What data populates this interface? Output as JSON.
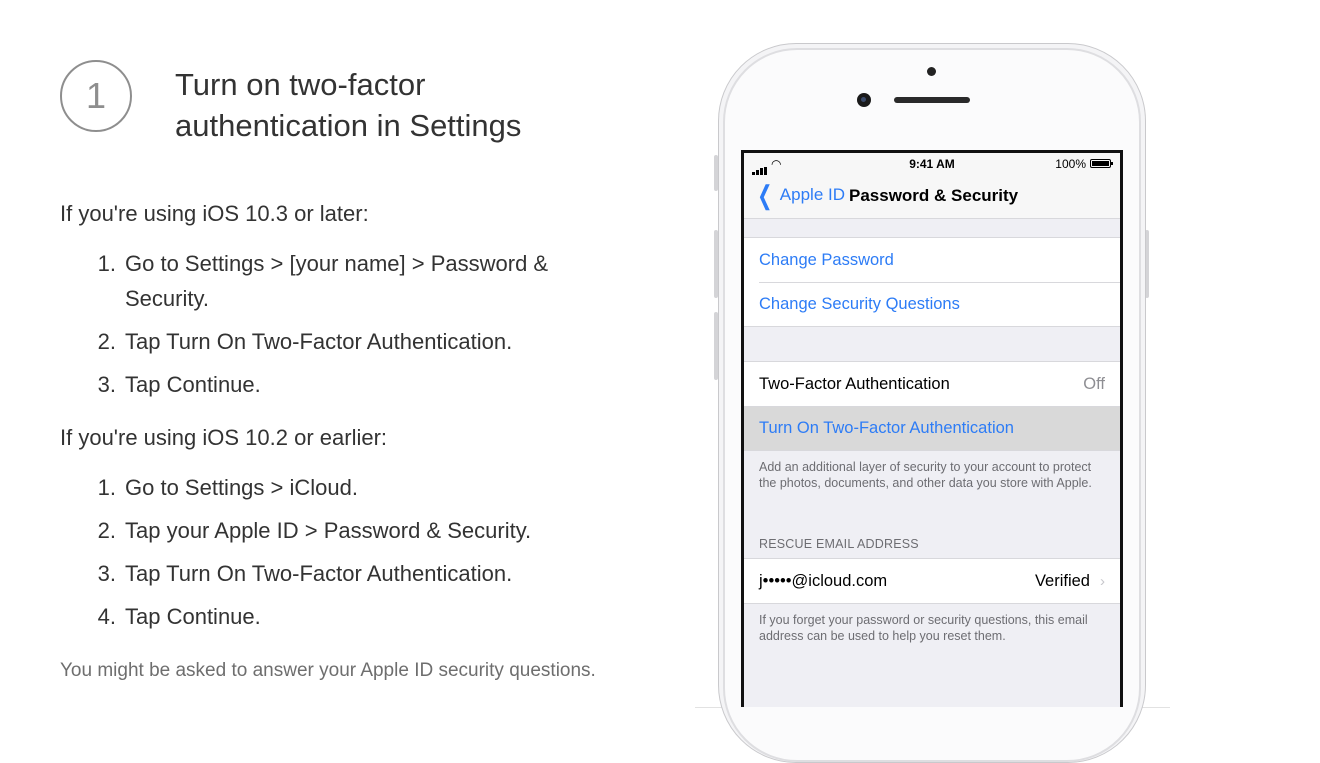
{
  "step": {
    "number": "1",
    "title_line1": "Turn on two-factor",
    "title_line2": "authentication in Settings"
  },
  "ios103": {
    "intro": "If you're using iOS 10.3 or later:",
    "steps": [
      {
        "num": "1.",
        "text": "Go to Settings > [your name] > Password & Security."
      },
      {
        "num": "2.",
        "text": "Tap Turn On Two-Factor Authentication."
      },
      {
        "num": "3.",
        "text": "Tap Continue."
      }
    ]
  },
  "ios102": {
    "intro": "If you're using iOS 10.2 or earlier:",
    "steps": [
      {
        "num": "1.",
        "text": "Go to Settings > iCloud."
      },
      {
        "num": "2.",
        "text": "Tap your Apple ID > Password & Security."
      },
      {
        "num": "3.",
        "text": "Tap Turn On Two-Factor Authentication."
      },
      {
        "num": "4.",
        "text": "Tap Continue."
      }
    ]
  },
  "note": "You might be asked to answer your Apple ID security questions.",
  "phone": {
    "status": {
      "wifi_icon": "wifi-icon",
      "time": "9:41 AM",
      "battery": "100%"
    },
    "nav": {
      "back_label": "Apple ID",
      "title": "Password & Security"
    },
    "group1": {
      "change_password": "Change Password",
      "change_questions": "Change Security Questions"
    },
    "group2": {
      "tfa_label": "Two-Factor Authentication",
      "tfa_value": "Off",
      "turn_on": "Turn On Two-Factor Authentication",
      "footer": "Add an additional layer of security to your account to protect the photos, documents, and other data you store with Apple."
    },
    "rescue": {
      "header": "RESCUE EMAIL ADDRESS",
      "email": "j•••••@icloud.com",
      "status": "Verified",
      "footer": "If you forget your password or security questions, this email address can be used to help you reset them."
    }
  },
  "colors": {
    "ios_blue": "#2d7cf6",
    "text": "#333333",
    "muted": "#6e6e6e",
    "highlight": "#d9d9d9"
  }
}
